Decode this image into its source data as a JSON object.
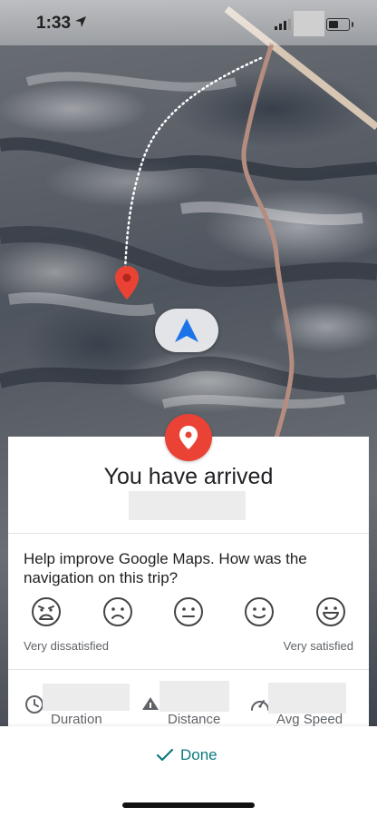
{
  "status_bar": {
    "time": "1:33"
  },
  "arrival_card": {
    "title": "You have arrived",
    "feedback_prompt": "Help improve Google Maps. How was the navigation on this trip?",
    "rating_options": [
      "very-dissatisfied",
      "dissatisfied",
      "neutral",
      "satisfied",
      "very-satisfied"
    ],
    "label_low": "Very dissatisfied",
    "label_high": "Very satisfied",
    "stats": [
      {
        "label": "Duration",
        "icon": "clock-icon"
      },
      {
        "label": "Distance",
        "icon": "distance-icon"
      },
      {
        "label": "Avg Speed",
        "icon": "speedometer-icon"
      }
    ]
  },
  "footer": {
    "done_label": "Done"
  },
  "colors": {
    "pin_red": "#ea4335",
    "nav_blue": "#1a73e8",
    "done_teal": "#0b7a80"
  }
}
